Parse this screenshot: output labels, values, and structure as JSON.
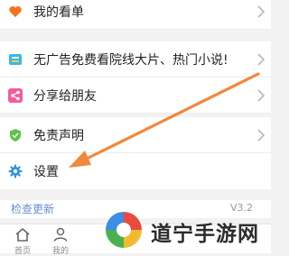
{
  "menu": {
    "items": [
      {
        "label": "我的看单",
        "icon": "heart-icon",
        "color": "#f5731e"
      },
      {
        "label": "无广告免费看院线大片、热门小说!",
        "icon": "book-icon",
        "color": "#3bb7e3"
      },
      {
        "label": "分享给朋友",
        "icon": "share-icon",
        "color": "#f25c9a"
      },
      {
        "label": "免责声明",
        "icon": "shield-icon",
        "color": "#5fc24a"
      },
      {
        "label": "设置",
        "icon": "gear-icon",
        "color": "#2f8fe0"
      }
    ]
  },
  "update": {
    "label": "检查更新",
    "version": "V3.2"
  },
  "tabs": [
    {
      "label": "首页",
      "icon": "home-icon"
    },
    {
      "label": "我的",
      "icon": "user-icon"
    }
  ],
  "watermark": {
    "text": "道宁手游网"
  },
  "colors": {
    "arrow": "#f0883e",
    "link": "#6a8bd2"
  }
}
